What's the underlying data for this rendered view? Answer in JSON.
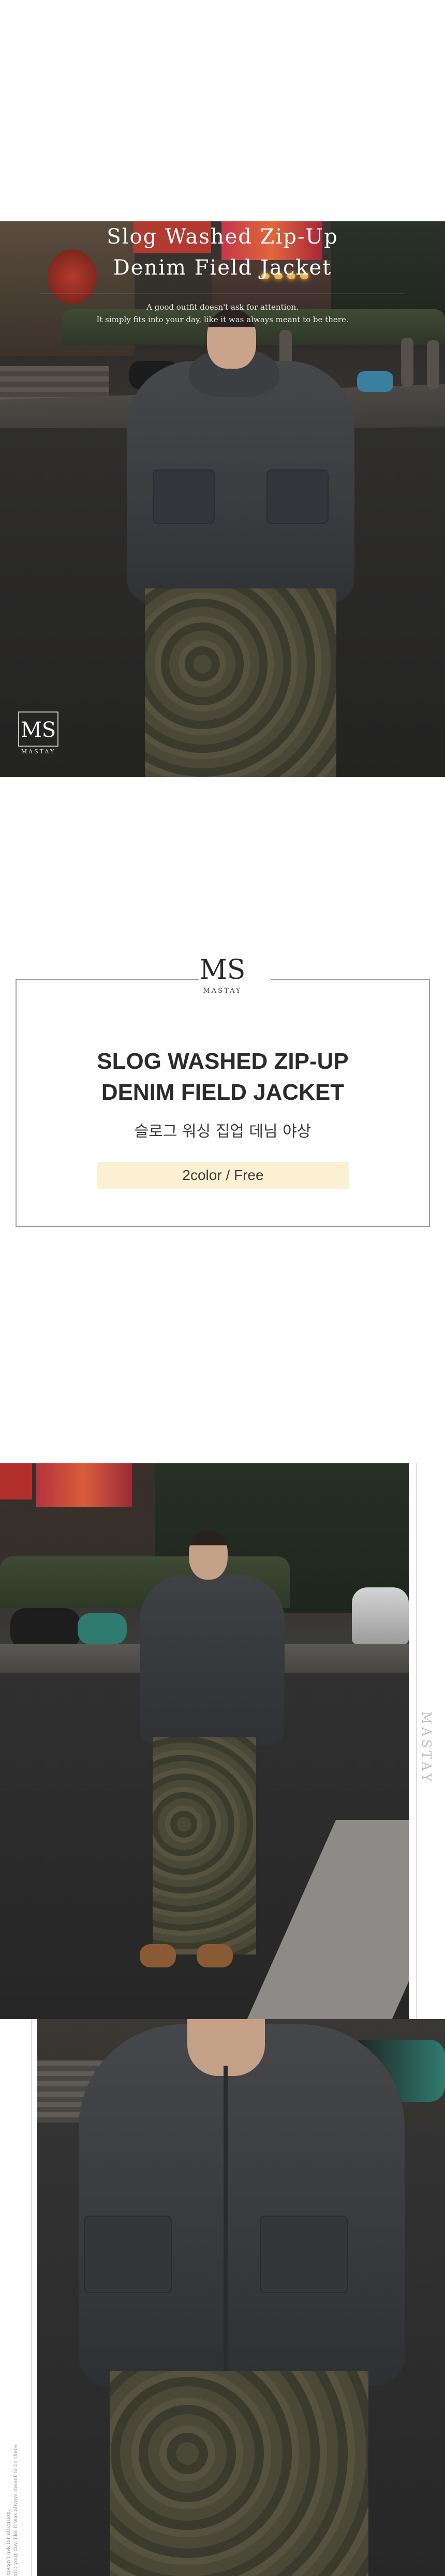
{
  "brand": {
    "monogram": "MS",
    "name": "MASTAY",
    "name_vertical": "MASTAY"
  },
  "hero": {
    "title_line1": "Slog Washed Zip-Up",
    "title_line2": "Denim Field Jacket",
    "subtitle_line1": "A good outfit doesn't ask for attention.",
    "subtitle_line2": "It simply fits into your day, like it was always meant to be there."
  },
  "info": {
    "title_line1": "SLOG WASHED ZIP-UP",
    "title_line2": "DENIM FIELD JACKET",
    "title_korean": "슬로그 워싱 집업 데님 야상",
    "option_badge": "2color / Free"
  },
  "side_caption": {
    "line1": "A good outfit doesn't ask for attention.",
    "line2": "It simply fits into your day, like it was always meant to be there."
  },
  "colors": {
    "badge_bg": "#fbf1d2",
    "card_border": "#9e9e9e",
    "text_dark": "#2b2b2b"
  }
}
